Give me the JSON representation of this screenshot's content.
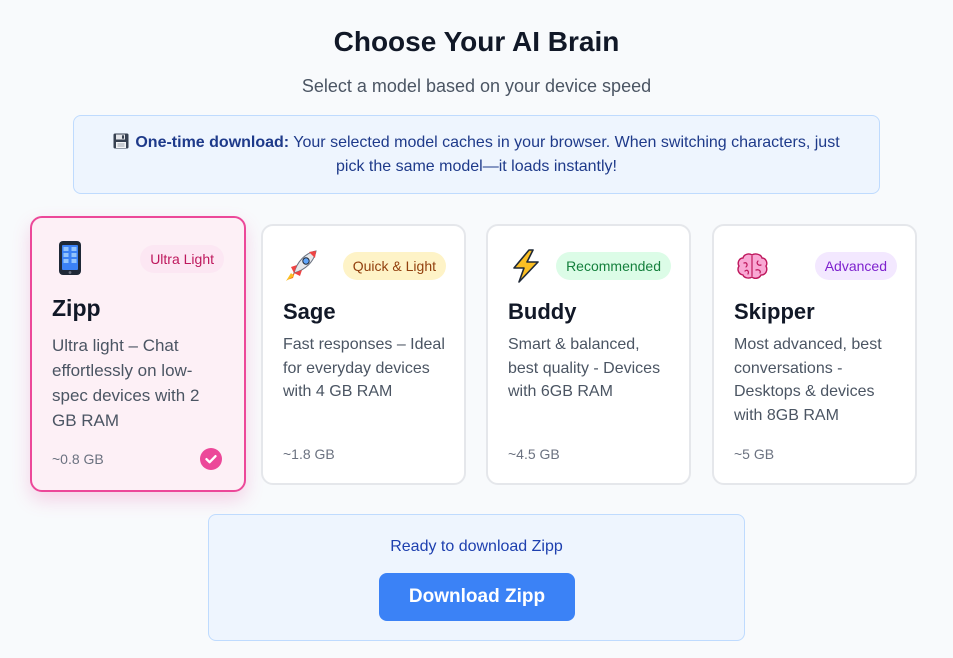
{
  "header": {
    "title": "Choose Your AI Brain",
    "subtitle": "Select a model based on your device speed"
  },
  "notice": {
    "icon": "floppy-disk-icon",
    "bold": "One-time download:",
    "text": "Your selected model caches in your browser. When switching characters, just pick the same model—it loads instantly!"
  },
  "models": [
    {
      "icon": "mobile-phone-icon",
      "badge": "Ultra Light",
      "name": "Zipp",
      "description": "Ultra light – Chat effortlessly on low-spec devices with 2 GB RAM",
      "size": "~0.8 GB",
      "selected": true
    },
    {
      "icon": "rocket-icon",
      "badge": "Quick & Light",
      "name": "Sage",
      "description": "Fast responses – Ideal for everyday devices with 4 GB RAM",
      "size": "~1.8 GB",
      "selected": false
    },
    {
      "icon": "lightning-icon",
      "badge": "Recommended",
      "name": "Buddy",
      "description": "Smart & balanced, best quality - Devices with 6GB RAM",
      "size": "~4.5 GB",
      "selected": false
    },
    {
      "icon": "brain-icon",
      "badge": "Advanced",
      "name": "Skipper",
      "description": "Most advanced, best conversations - Desktops & devices with 8GB RAM",
      "size": "~5 GB",
      "selected": false
    }
  ],
  "download": {
    "status": "Ready to download Zipp",
    "button_label": "Download Zipp"
  },
  "colors": {
    "accent": "#ec4899",
    "primary_button": "#3b82f6",
    "info_bg": "#eef5fe"
  }
}
